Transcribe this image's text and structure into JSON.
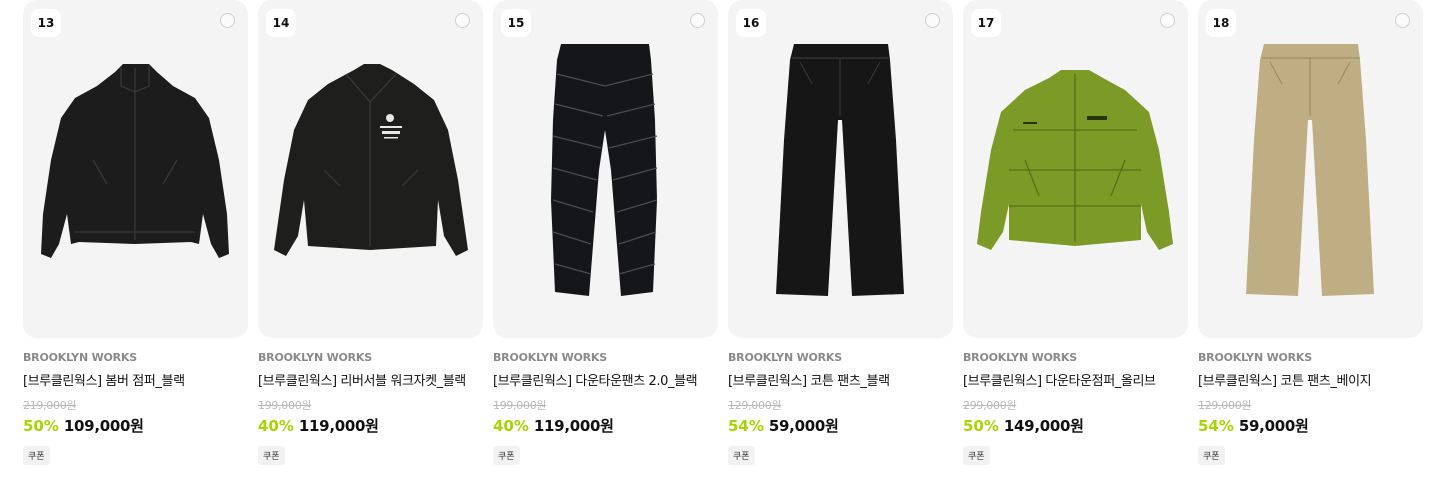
{
  "products": [
    {
      "rank": "13",
      "brand": "BROOKLYN WORKS",
      "name": "[브루클린웍스] 봄버 점퍼_블랙",
      "original_price": "219,000원",
      "discount": "50%",
      "price": "109,000원",
      "coupon": "쿠폰",
      "image_icon": "black-bomber-jacket-image",
      "color": "#1c1c1c"
    },
    {
      "rank": "14",
      "brand": "BROOKLYN WORKS",
      "name": "[브루클린웍스] 리버서블 워크자켓_블랙",
      "original_price": "199,000원",
      "discount": "40%",
      "price": "119,000원",
      "coupon": "쿠폰",
      "image_icon": "black-work-jacket-image",
      "color": "#1e1e1c"
    },
    {
      "rank": "15",
      "brand": "BROOKLYN WORKS",
      "name": "[브루클린웍스] 다운타운팬츠 2.0_블랙",
      "original_price": "199,000원",
      "discount": "40%",
      "price": "119,000원",
      "coupon": "쿠폰",
      "image_icon": "black-down-pants-image",
      "color": "#15161a"
    },
    {
      "rank": "16",
      "brand": "BROOKLYN WORKS",
      "name": "[브루클린웍스] 코튼 팬츠_블랙",
      "original_price": "129,000원",
      "discount": "54%",
      "price": "59,000원",
      "coupon": "쿠폰",
      "image_icon": "black-cotton-pants-image",
      "color": "#161616"
    },
    {
      "rank": "17",
      "brand": "BROOKLYN WORKS",
      "name": "[브루클린웍스] 다운타운점퍼_올리브",
      "original_price": "299,000원",
      "discount": "50%",
      "price": "149,000원",
      "coupon": "쿠폰",
      "image_icon": "olive-puffer-jacket-image",
      "color": "#7c9a26"
    },
    {
      "rank": "18",
      "brand": "BROOKLYN WORKS",
      "name": "[브루클린웍스] 코튼 팬츠_베이지",
      "original_price": "129,000원",
      "discount": "54%",
      "price": "59,000원",
      "coupon": "쿠폰",
      "image_icon": "beige-cotton-pants-image",
      "color": "#bfae84"
    }
  ],
  "colors": {
    "discount": "#a8d400",
    "card_bg": "#f4f4f4",
    "brand_text": "#8a8a8a"
  }
}
